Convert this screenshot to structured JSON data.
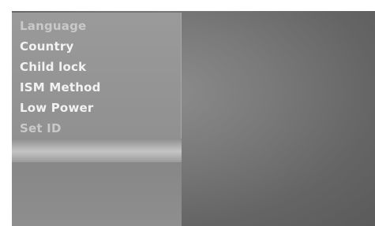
{
  "menu": {
    "items": [
      {
        "label": "Language",
        "state": "dim"
      },
      {
        "label": "Country",
        "state": "normal"
      },
      {
        "label": "Child lock",
        "state": "normal"
      },
      {
        "label": "ISM Method",
        "state": "normal"
      },
      {
        "label": "Low Power",
        "state": "normal"
      },
      {
        "label": "Set ID",
        "state": "dim"
      }
    ]
  },
  "colors": {
    "menu_text": "#f2f2f2",
    "menu_text_dim": "#c9c9c9",
    "panel": "#919191",
    "background": "#707070"
  }
}
